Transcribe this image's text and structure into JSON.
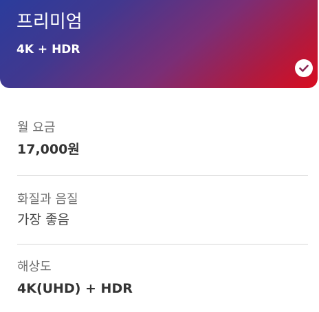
{
  "plan": {
    "name": "프리미엄",
    "quality": "4K + HDR",
    "selected": true,
    "gradient_colors": [
      "#2b3c9c",
      "#7a2e76",
      "#d90d20"
    ],
    "check_icon": "check-circle-icon"
  },
  "details": {
    "monthly_price": {
      "label": "월 요금",
      "value": "17,000원"
    },
    "video_audio_quality": {
      "label": "화질과 음질",
      "value": "가장 좋음"
    },
    "resolution": {
      "label": "해상도",
      "value": "4K(UHD) + HDR"
    }
  }
}
